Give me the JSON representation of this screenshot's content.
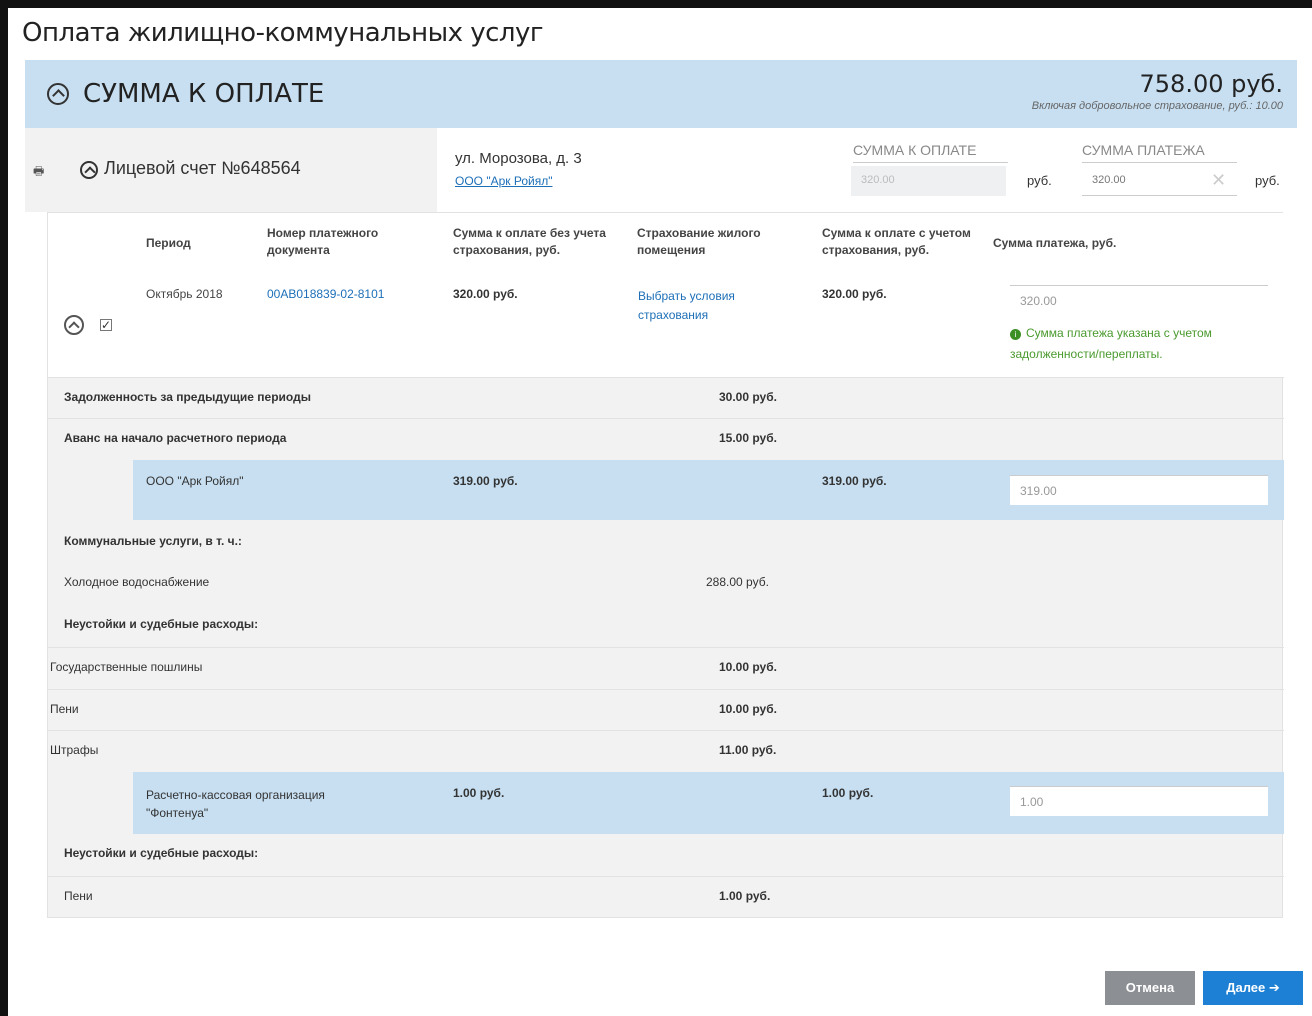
{
  "page_title": "Оплата жилищно-коммунальных услуг",
  "summary": {
    "label": "СУММА К ОПЛАТЕ",
    "total": "758.00 руб.",
    "includes": "Включая добровольное страхование, руб.: 10.00"
  },
  "account": {
    "title": "Лицевой счет №648564",
    "address": "ул. Морозова, д. 3",
    "org_link": "ООО \"Арк Ройял\"",
    "due_header": "СУММА К ОПЛАТЕ",
    "pay_header": "СУММА ПЛАТЕЖА",
    "due_value": "320.00",
    "pay_value": "320.00",
    "currency": "руб."
  },
  "table": {
    "headers": {
      "period": "Период",
      "doc": "Номер платежного документа",
      "sum_no_ins": "Сумма к оплате без учета страхования, руб.",
      "insurance": "Страхование жилого помещения",
      "sum_with_ins": "Сумма к оплате с учетом страхования, руб.",
      "payment": "Сумма платежа, руб."
    },
    "main_row": {
      "period": "Октябрь 2018",
      "doc": "00АВ018839-02-8101",
      "sum_no_ins": "320.00 руб.",
      "insurance_link": "Выбрать условия страхования",
      "sum_with_ins": "320.00 руб.",
      "payment": "320.00",
      "note": "Сумма платежа указана с учетом задолженности/переплаты."
    },
    "debt": {
      "label": "Задолженность за предыдущие периоды",
      "value": "30.00 руб."
    },
    "advance": {
      "label": "Аванс на начало расчетного периода",
      "value": "15.00 руб."
    },
    "provider1": {
      "name": "ООО \"Арк Ройял\"",
      "sum_no_ins": "319.00 руб.",
      "sum_with_ins": "319.00 руб.",
      "payment": "319.00"
    },
    "utilities_label": "Коммунальные услуги, в т. ч.:",
    "cold_water": {
      "label": "Холодное водоснабжение",
      "value": "288.00 руб."
    },
    "penalties_label": "Неустойки и судебные расходы:",
    "duties": {
      "label": "Государственные пошлины",
      "value": "10.00 руб."
    },
    "peni": {
      "label": "Пени",
      "value": "10.00 руб."
    },
    "fines": {
      "label": "Штрафы",
      "value": "11.00 руб."
    },
    "provider2": {
      "name": "Расчетно-кассовая организация \"Фонтенуа\"",
      "sum_no_ins": "1.00 руб.",
      "sum_with_ins": "1.00 руб.",
      "payment": "1.00"
    },
    "penalties2_label": "Неустойки и судебные расходы:",
    "peni2": {
      "label": "Пени",
      "value": "1.00 руб."
    }
  },
  "buttons": {
    "cancel": "Отмена",
    "next": "Далее ➔"
  }
}
